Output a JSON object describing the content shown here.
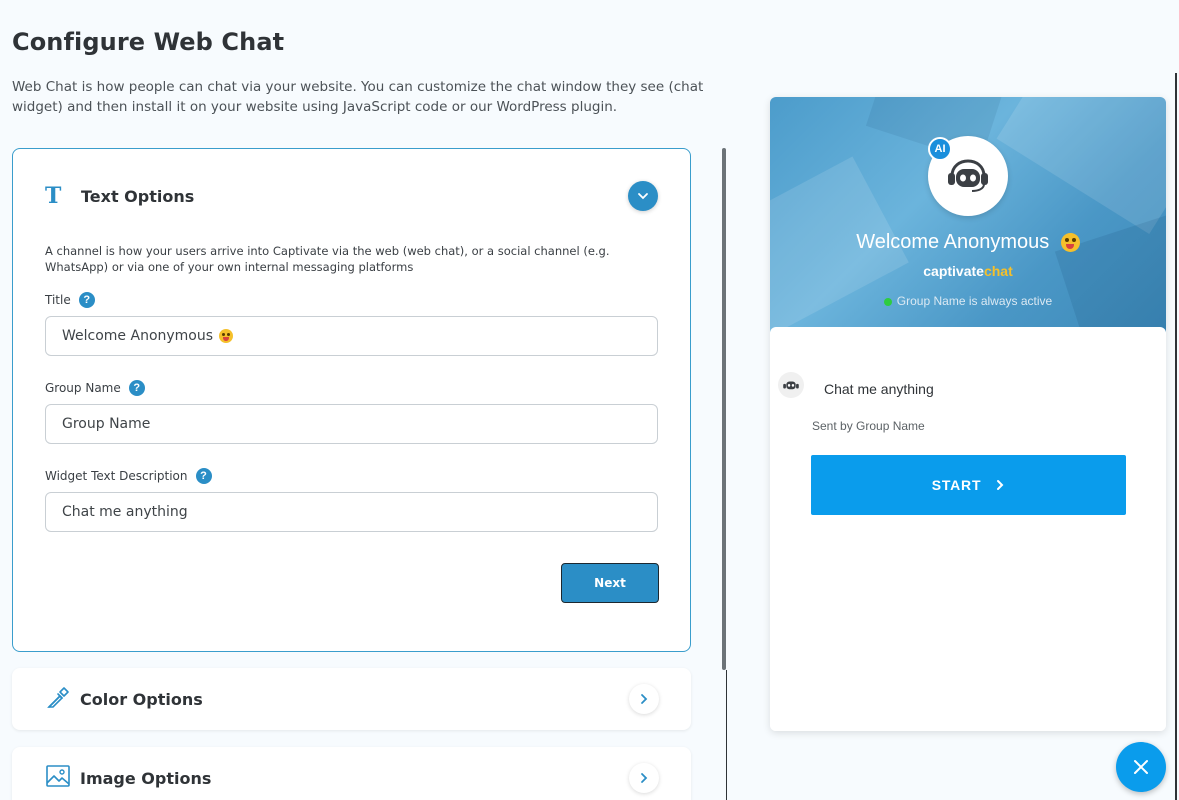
{
  "page": {
    "title": "Configure Web Chat",
    "description": "Web Chat is how people can chat via your website. You can customize the chat window they see (chat widget) and then install it on your website using JavaScript code or our WordPress plugin."
  },
  "text_options": {
    "title": "Text Options",
    "icon": "text-format-icon",
    "description": "A channel is how your users arrive into Captivate via the web (web chat), or a social channel (e.g. WhatsApp) or via one of your own internal messaging platforms",
    "fields": {
      "title_label": "Title",
      "title_value": "Welcome Anonymous",
      "group_name_label": "Group Name",
      "group_name_value": "Group Name",
      "widget_desc_label": "Widget Text Description",
      "widget_desc_value": "Chat me anything"
    },
    "help_glyph": "?",
    "next_label": "Next"
  },
  "color_options": {
    "title": "Color Options",
    "icon": "eyedropper-icon"
  },
  "image_options": {
    "title": "Image Options",
    "icon": "image-icon"
  },
  "preview": {
    "ai_badge": "AI",
    "welcome": "Welcome Anonymous",
    "brand_part1": "captivate",
    "brand_part2": "chat",
    "status": "Group Name is always active",
    "message": "Chat me anything",
    "sent_by": "Sent by Group Name",
    "start_label": "START"
  },
  "colors": {
    "accent": "#2b8ec6",
    "start_button": "#0a9cec",
    "brand_yellow": "#f5c02b",
    "status_green": "#2ecc40"
  }
}
